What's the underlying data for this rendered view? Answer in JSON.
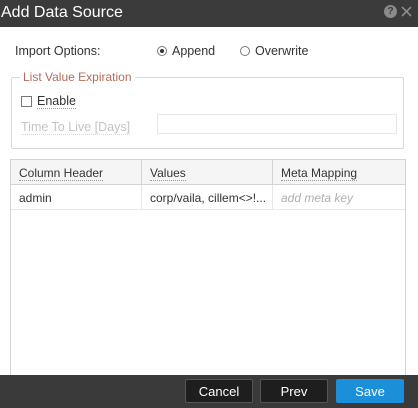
{
  "dialog": {
    "title": "Add Data Source",
    "help_glyph": "?",
    "close_icon": "close-icon"
  },
  "import_options": {
    "label": "Import Options:",
    "options": [
      {
        "label": "Append",
        "checked": true
      },
      {
        "label": "Overwrite",
        "checked": false
      }
    ]
  },
  "list_value_expiration": {
    "legend": "List Value Expiration",
    "enable_label": "Enable",
    "enable_checked": false,
    "ttl_label": "Time To Live [Days]",
    "ttl_value": ""
  },
  "table": {
    "columns": [
      "Column Header",
      "Values",
      "Meta Mapping"
    ],
    "rows": [
      {
        "column_header": "admin",
        "values": "corp/vaila, cillem<>!...",
        "meta_mapping": "add meta key"
      }
    ]
  },
  "buttons": {
    "cancel": "Cancel",
    "prev": "Prev",
    "save": "Save"
  },
  "colors": {
    "title_bar": "#3b3b3b",
    "primary_button": "#1c8fdb",
    "legend_text": "#b36b5c"
  }
}
